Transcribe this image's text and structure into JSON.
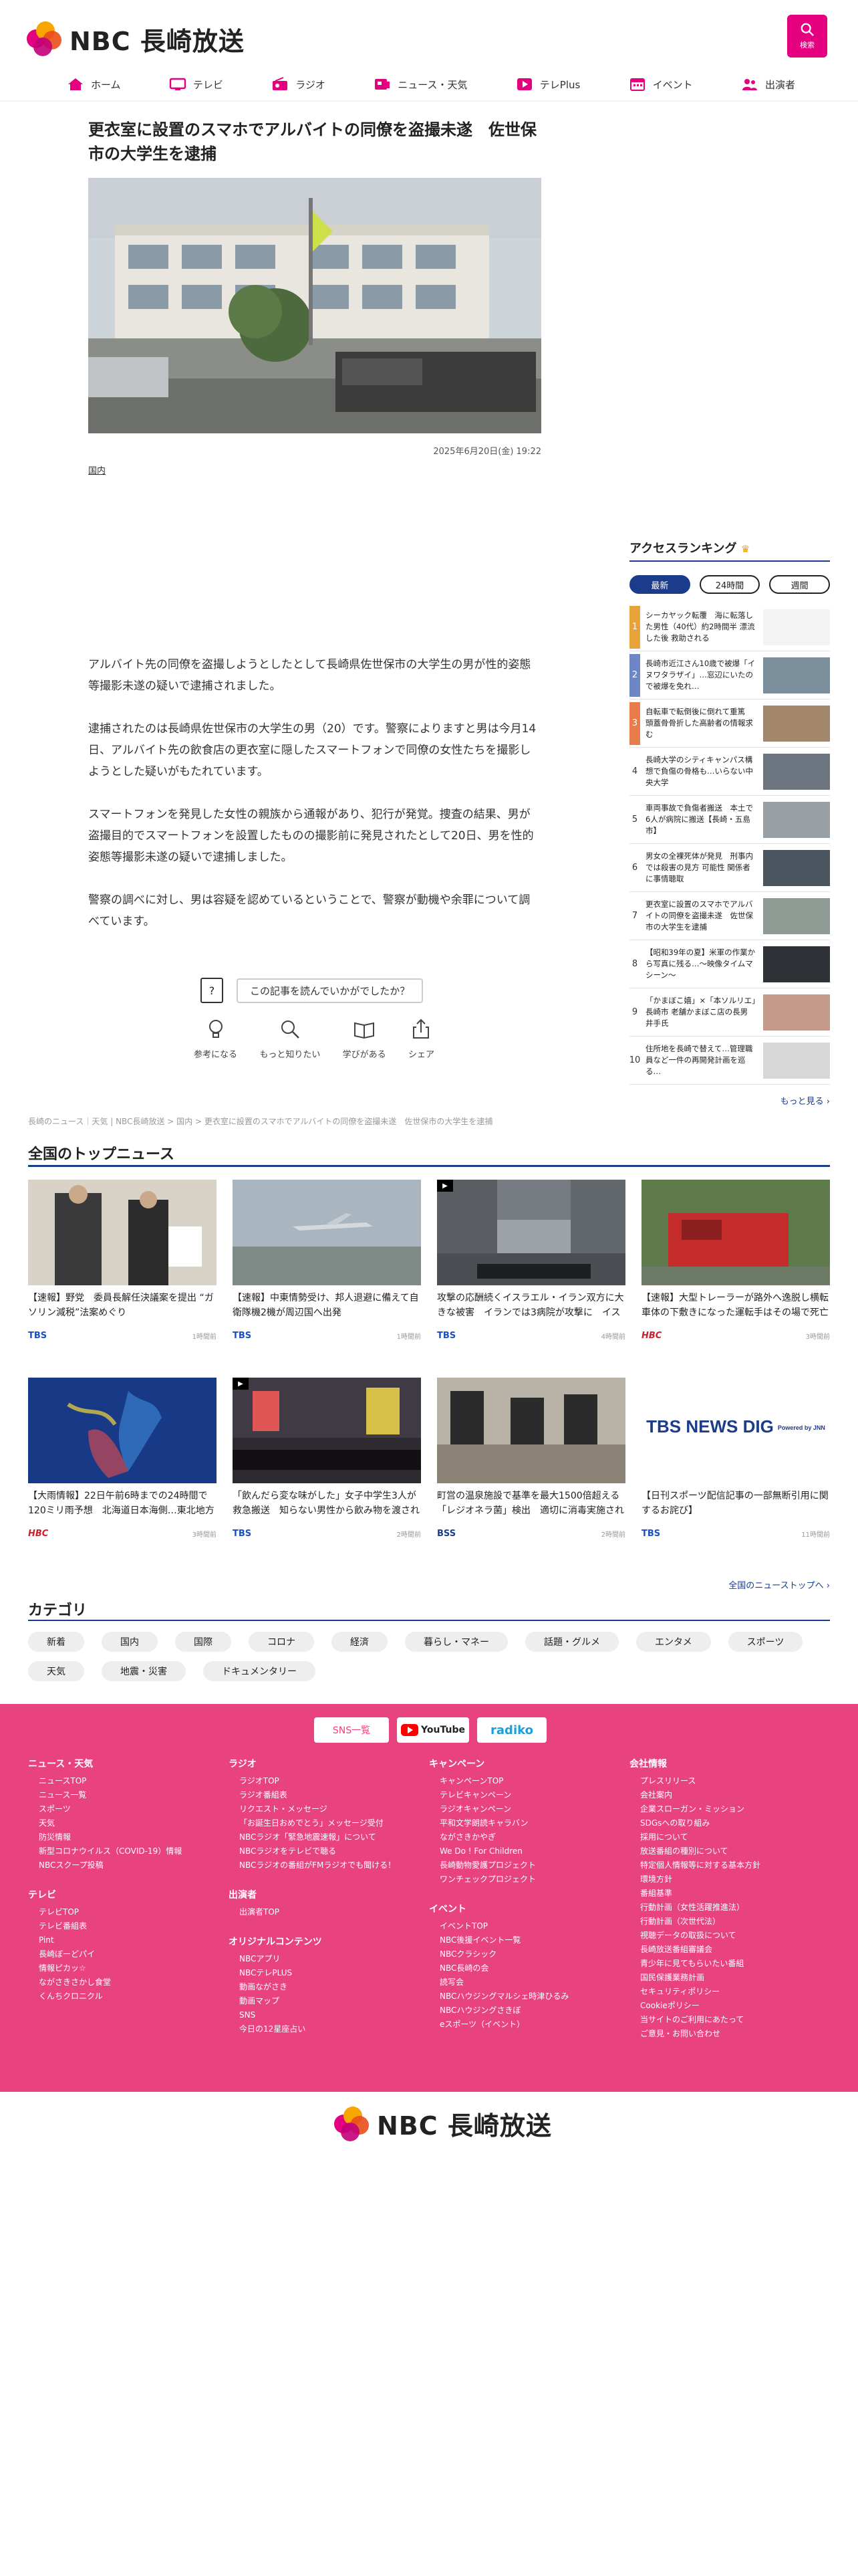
{
  "site": {
    "logo_text": "NBC 長崎放送",
    "search_label": "検索"
  },
  "nav": [
    {
      "label": "ホーム",
      "icon": "home-icon"
    },
    {
      "label": "テレビ",
      "icon": "tv-icon"
    },
    {
      "label": "ラジオ",
      "icon": "radio-icon"
    },
    {
      "label": "ニュース・天気",
      "icon": "news-icon"
    },
    {
      "label": "テレPlus",
      "icon": "play-icon"
    },
    {
      "label": "イベント",
      "icon": "calendar-icon"
    },
    {
      "label": "出演者",
      "icon": "people-icon"
    }
  ],
  "article": {
    "title": "更衣室に設置のスマホでアルバイトの同僚を盗撮未遂　佐世保市の大学生を逮捕",
    "date": "2025年6月20日(金) 19:22",
    "tag": "国内",
    "body": [
      "アルバイト先の同僚を盗撮しようとしたとして長崎県佐世保市の大学生の男が性的姿態等撮影未遂の疑いで逮捕されました。",
      "逮捕されたのは長崎県佐世保市の大学生の男（20）です。警察によりますと男は今月14日、アルバイト先の飲食店の更衣室に隠したスマートフォンで同僚の女性たちを撮影しようとした疑いがもたれています。",
      "スマートフォンを発見した女性の親族から通報があり、犯行が発覚。捜査の結果、男が盗撮目的でスマートフォンを設置したものの撮影前に発見されたとして20日、男を性的姿態等撮影未遂の疑いで逮捕しました。",
      "警察の調べに対し、男は容疑を認めているということで、警察が動機や余罪について調べています。"
    ]
  },
  "reaction": {
    "question": "この記事を読んでいかがでしたか？",
    "buttons": [
      "参考になる",
      "もっと知りたい",
      "学びがある",
      "シェア"
    ]
  },
  "ranking": {
    "title": "アクセスランキング",
    "tabs": [
      "最新",
      "24時間",
      "週間"
    ],
    "items": [
      {
        "num": "1",
        "text": "シーカヤック転覆　海に転落した男性（40代）約2時間半 漂流した後 救助される",
        "color": "#e8a23a"
      },
      {
        "num": "2",
        "text": "長崎市近江さん10歳で被爆「イヌワタラザイ」…窓辺にいたので被爆を免れ…",
        "color": "#6d86c7"
      },
      {
        "num": "3",
        "text": "自転車で転倒後に倒れて重篤　頭蓋骨骨折した高齢者の情報求む",
        "color": "#e77d4a"
      },
      {
        "num": "4",
        "text": "長崎大学のシティキャンパス構想で負傷の骨格も…いらない中央大学",
        "color": ""
      },
      {
        "num": "5",
        "text": "車両事故で負傷者搬送　本土で6人が病院に搬送【長崎・五島市】",
        "color": ""
      },
      {
        "num": "6",
        "text": "男女の全裸死体が発見　刑事内では殺害の見方 可能性 関係者に事情聴取",
        "color": ""
      },
      {
        "num": "7",
        "text": "更衣室に設置のスマホでアルバイトの同僚を盗撮未遂　佐世保市の大学生を逮捕",
        "color": ""
      },
      {
        "num": "8",
        "text": "【昭和39年の夏】米軍の作業から写真に残る…〜映像タイムマシーン〜",
        "color": ""
      },
      {
        "num": "9",
        "text": "「かまぼこ嬉」×「本ソルリエ」長崎市 老舗かまぼこ店の長男 井手氏",
        "color": ""
      },
      {
        "num": "10",
        "text": "住所地を長崎で替えて…管理職員など一件の再開発計画を巡る…",
        "color": ""
      }
    ],
    "more": "もっと見る"
  },
  "breadcrumb": "長崎のニュース｜天気 | NBC長崎放送 > 国内 > 更衣室に設置のスマホでアルバイトの同僚を盗撮未遂　佐世保市の大学生を逮捕",
  "top_news": {
    "title": "全国のトップニュース",
    "items": [
      {
        "title": "【速報】野党　委員長解任決議案を提出 “ガソリン減税”法案めぐり",
        "source": "TBS",
        "time": "1時間前",
        "src_color": "#1a4fbf",
        "thumb": "a"
      },
      {
        "title": "【速報】中東情勢受け、邦人退避に備えて自衛隊機2機が周辺国へ出発",
        "source": "TBS",
        "time": "1時間前",
        "src_color": "#1a4fbf",
        "thumb": "b"
      },
      {
        "title": "攻撃の応酬続くイスラエル・イラン双方に大きな被害　イランでは3病院が攻撃に　イスラエル北部ハイファで20…",
        "source": "TBS",
        "time": "4時間前",
        "src_color": "#1a4fbf",
        "thumb": "c"
      },
      {
        "title": "【速報】大型トレーラーが路外へ逸脱し横転　車体の下敷きになった運転手はその場で死亡確認　北海道江別市…",
        "source": "HBC",
        "time": "3時間前",
        "src_color": "#d0202a",
        "thumb": "d"
      },
      {
        "title": "【大雨情報】22日午前6時までの24時間で120ミリ雨予想　北海道日本海側…東北地方も23日朝までに100ミ…",
        "source": "HBC",
        "time": "3時間前",
        "src_color": "#d0202a",
        "thumb": "e"
      },
      {
        "title": "「飲んだら変な味がした」女子中学生3人が救急搬送　知らない男性から飲み物を渡され体調が悪くなったか　東…",
        "source": "TBS",
        "time": "2時間前",
        "src_color": "#1a4fbf",
        "thumb": "f"
      },
      {
        "title": "町営の温泉施設で基準を最大1500倍超える「レジオネラ菌」検出　適切に消毒実施されておらず保健所が改善指…",
        "source": "BSS",
        "time": "2時間前",
        "src_color": "#1a3c8a",
        "thumb": "g"
      },
      {
        "title": "【日刊スポーツ配信記事の一部無断引用に関するお詫び】",
        "source": "TBS",
        "time": "11時間前",
        "src_color": "#1a4fbf",
        "thumb": "h"
      }
    ],
    "more": "全国のニューストップへ"
  },
  "thumb_h_text": "TBS NEWS DIG",
  "thumb_h_sub": "Powered by JNN",
  "categories": {
    "title": "カテゴリ",
    "items": [
      "新着",
      "国内",
      "国際",
      "コロナ",
      "経済",
      "暮らし・マネー",
      "話題・グルメ",
      "エンタメ",
      "スポーツ",
      "天気",
      "地震・災害",
      "ドキュメンタリー"
    ]
  },
  "footer": {
    "sns": [
      "SNS一覧",
      "YouTube",
      "radiko"
    ],
    "columns": [
      [
        {
          "h": "ニュース・天気",
          "items": [
            "ニュースTOP",
            "ニュース一覧",
            "スポーツ",
            "天気",
            "防災情報",
            "新型コロナウイルス（COVID-19）情報",
            "NBCスクープ投稿"
          ]
        },
        {
          "h": "テレビ",
          "items": [
            "テレビTOP",
            "テレビ番組表",
            "Pint",
            "長崎ぼーどパイ",
            "情報ピカッ☆",
            "ながさきさかし食堂",
            "くんちクロニクル"
          ]
        }
      ],
      [
        {
          "h": "ラジオ",
          "items": [
            "ラジオTOP",
            "ラジオ番組表",
            "リクエスト・メッセージ",
            "「お誕生日おめでとう」メッセージ受付",
            "NBCラジオ「緊急地震速報」について",
            "NBCラジオをテレビで聴る",
            "NBCラジオの番組がFMラジオでも聞ける！"
          ]
        },
        {
          "h": "出演者",
          "items": [
            "出演者TOP"
          ]
        },
        {
          "h": "オリジナルコンテンツ",
          "items": [
            "NBCアプリ",
            "NBCテレPLUS",
            "動画ながさき",
            "動画マップ",
            "SNS",
            "今日の12星座占い"
          ]
        }
      ],
      [
        {
          "h": "キャンペーン",
          "items": [
            "キャンペーンTOP",
            "テレビキャンペーン",
            "ラジオキャンペーン",
            "平和文学朗読キャラバン",
            "ながさきかやぎ",
            "We Do ! For Children",
            "長崎動物愛護プロジェクト",
            "ワンチェックプロジェクト"
          ]
        },
        {
          "h": "イベント",
          "items": [
            "イベントTOP",
            "NBC後援イベント一覧",
            "NBCクラシック",
            "NBC長崎の会",
            "読写会",
            "NBCハウジングマルシェ時津ひるみ",
            "NBCハウジングさきぼ",
            "eスポーツ（イベント）"
          ]
        }
      ],
      [
        {
          "h": "会社情報",
          "items": [
            "プレスリリース",
            "会社案内",
            "企業スローガン・ミッション",
            "SDGsへの取り組み",
            "採用について",
            "放送番組の種別について",
            "特定個人情報等に対する基本方針",
            "環境方針",
            "番組基準",
            "行動計画（女性活躍推進法）",
            "行動計画（次世代法）",
            "視聴データの取扱について",
            "長崎放送番組審議会",
            "青少年に見てもらいたい番組",
            "国民保護業務計画",
            "セキュリティポリシー",
            "Cookieポリシー",
            "当サイトのご利用にあたって",
            "ご意見・お問い合わせ"
          ]
        }
      ]
    ]
  }
}
